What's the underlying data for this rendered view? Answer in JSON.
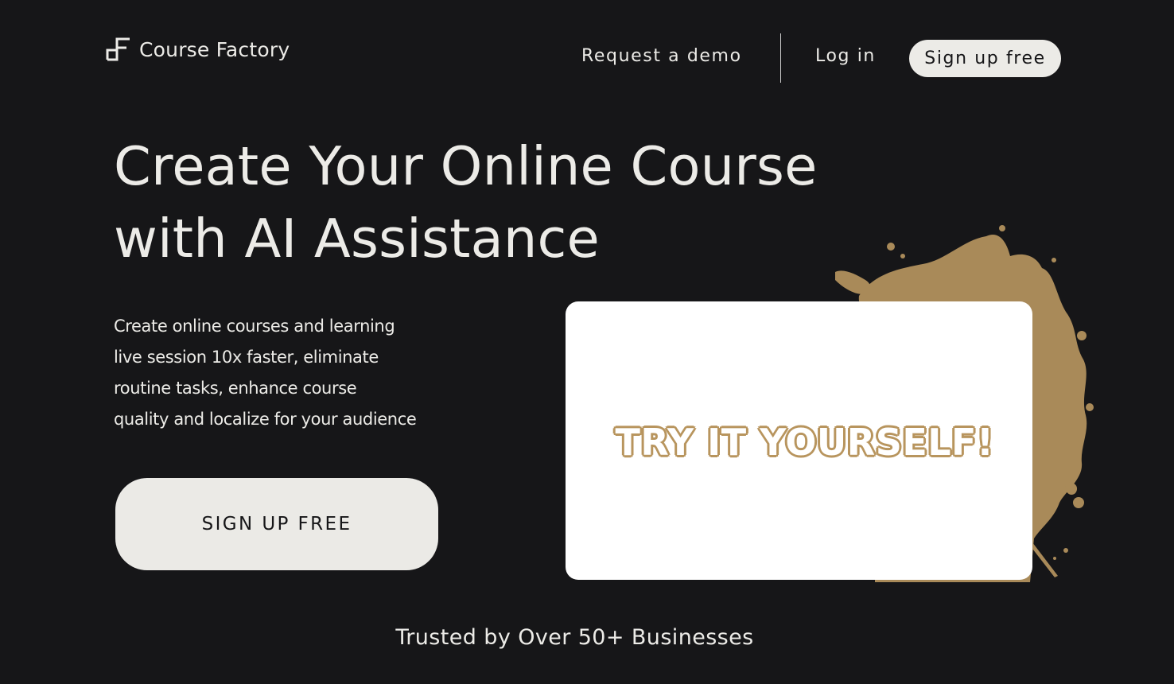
{
  "brand": {
    "name": "Course Factory",
    "icon": "course-factory-logo-icon"
  },
  "nav": {
    "request_demo": "Request a demo",
    "login": "Log in",
    "signup": "Sign up free"
  },
  "hero": {
    "title_line1": "Create Your Online Course",
    "title_line2": "with AI Assistance",
    "description_lines": [
      "Create online courses and learning",
      "live session 10x faster, eliminate",
      "routine tasks, enhance course",
      "quality and localize for your audience"
    ],
    "cta": "SIGN UP FREE"
  },
  "demo_card": {
    "text": "TRY IT YOURSELF!"
  },
  "trusted": "Trusted by Over 50+ Businesses",
  "colors": {
    "background": "#161618",
    "text": "#ecebe7",
    "accent_gold": "#a98a59",
    "card": "#ffffff"
  }
}
